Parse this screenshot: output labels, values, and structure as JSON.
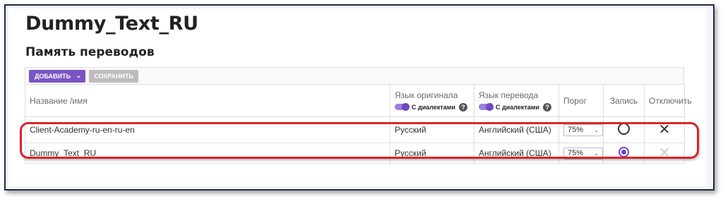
{
  "page": {
    "title": "Dummy_Text_RU",
    "subtitle": "Память переводов"
  },
  "toolbar": {
    "add_label": "ДОБАВИТЬ",
    "save_label": "СОХРАНИТЬ"
  },
  "table": {
    "headers": {
      "name": "Название /имя",
      "source_lang": "Язык оригинала",
      "target_lang": "Язык перевода",
      "threshold": "Порог",
      "write": "Запись",
      "disable": "Отключить"
    },
    "dialects_label": "С диалектами",
    "help_glyph": "?",
    "rows": [
      {
        "name": "Client-Academy-ru-en-ru-en",
        "source": "Русский",
        "target": "Английский (США)",
        "threshold": "75%",
        "write_selected": false,
        "disable_icon": "close-icon"
      },
      {
        "name": "Dummy_Text_RU",
        "source": "Русский",
        "target": "Английский (США)",
        "threshold": "75%",
        "write_selected": true,
        "disable_icon": "close-icon"
      }
    ]
  },
  "colors": {
    "accent": "#7a55c5",
    "highlight": "#d8262a",
    "save_disabled": "#bdbdbd"
  }
}
